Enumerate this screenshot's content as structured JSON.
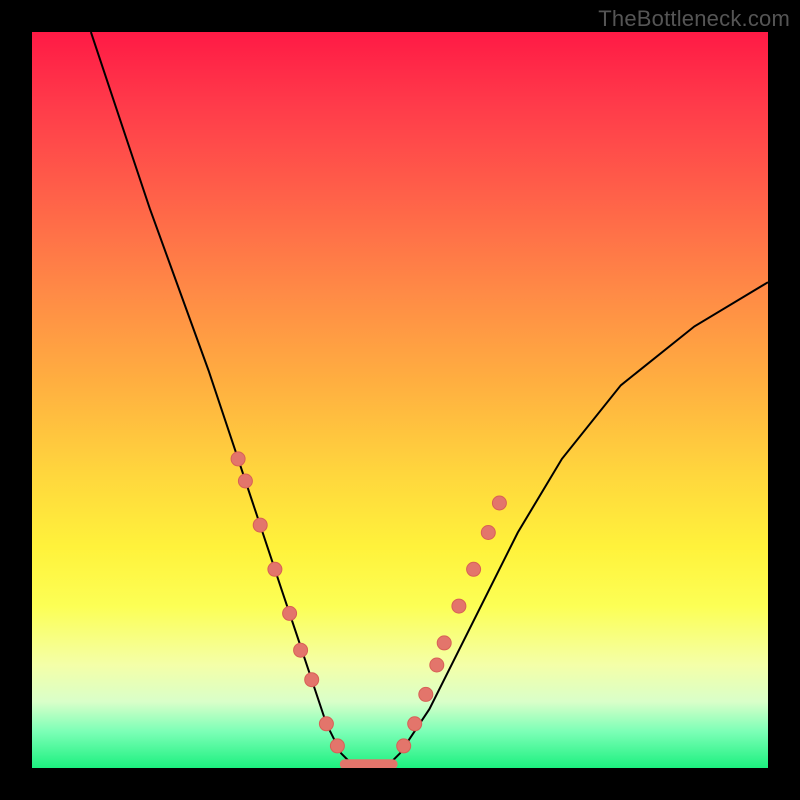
{
  "watermark": "TheBottleneck.com",
  "colors": {
    "top": "#ff1a45",
    "mid": "#fff23b",
    "bottom": "#1cf07f",
    "curve": "#000000",
    "marker": "#e3756b",
    "frame": "#000000"
  },
  "chart_data": {
    "type": "line",
    "title": "",
    "xlabel": "",
    "ylabel": "",
    "xlim": [
      0,
      100
    ],
    "ylim": [
      0,
      100
    ],
    "series": [
      {
        "name": "bottleneck-curve",
        "x": [
          8,
          12,
          16,
          20,
          24,
          28,
          30,
          32,
          34,
          36,
          38,
          40,
          42,
          44,
          46,
          48,
          50,
          54,
          58,
          62,
          66,
          72,
          80,
          90,
          100
        ],
        "values": [
          100,
          88,
          76,
          65,
          54,
          42,
          36,
          30,
          24,
          18,
          12,
          6,
          2,
          0,
          0,
          0,
          2,
          8,
          16,
          24,
          32,
          42,
          52,
          60,
          66
        ]
      }
    ],
    "markers_left": [
      {
        "x": 28,
        "y": 42
      },
      {
        "x": 29,
        "y": 39
      },
      {
        "x": 31,
        "y": 33
      },
      {
        "x": 33,
        "y": 27
      },
      {
        "x": 35,
        "y": 21
      },
      {
        "x": 36.5,
        "y": 16
      },
      {
        "x": 38,
        "y": 12
      },
      {
        "x": 40,
        "y": 6
      },
      {
        "x": 41.5,
        "y": 3
      }
    ],
    "markers_right": [
      {
        "x": 50.5,
        "y": 3
      },
      {
        "x": 52,
        "y": 6
      },
      {
        "x": 53.5,
        "y": 10
      },
      {
        "x": 55,
        "y": 14
      },
      {
        "x": 56,
        "y": 17
      },
      {
        "x": 58,
        "y": 22
      },
      {
        "x": 60,
        "y": 27
      },
      {
        "x": 62,
        "y": 32
      },
      {
        "x": 63.5,
        "y": 36
      }
    ],
    "plateau": {
      "x_start": 42.5,
      "x_end": 49,
      "y": 0.5
    }
  }
}
